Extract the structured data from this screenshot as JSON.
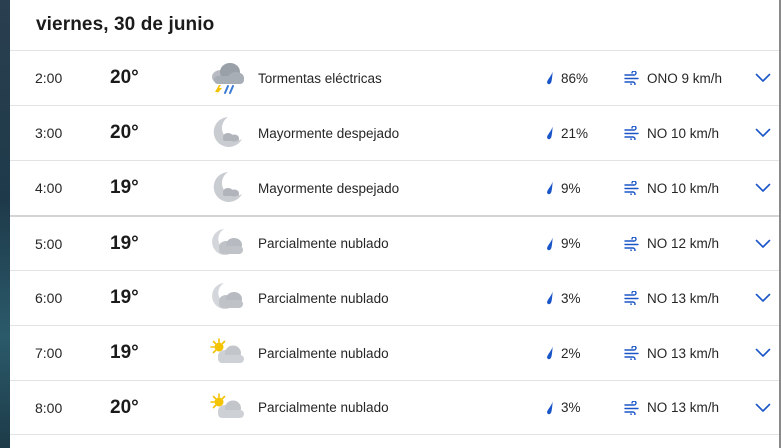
{
  "header": {
    "date": "viernes, 30 de junio"
  },
  "rows": [
    {
      "time": "2:00",
      "temp": "20°",
      "icon": "thunderstorm-icon",
      "condition": "Tormentas eléctricas",
      "precip": "86%",
      "wind": "ONO 9 km/h"
    },
    {
      "time": "3:00",
      "temp": "20°",
      "icon": "mostly-clear-night-icon",
      "condition": "Mayormente despejado",
      "precip": "21%",
      "wind": "NO 10 km/h"
    },
    {
      "time": "4:00",
      "temp": "19°",
      "icon": "mostly-clear-night-icon",
      "condition": "Mayormente despejado",
      "precip": "9%",
      "wind": "NO 10 km/h"
    },
    {
      "time": "5:00",
      "temp": "19°",
      "icon": "partly-cloudy-night-icon",
      "condition": "Parcialmente nublado",
      "precip": "9%",
      "wind": "NO 12 km/h"
    },
    {
      "time": "6:00",
      "temp": "19°",
      "icon": "partly-cloudy-night-icon",
      "condition": "Parcialmente nublado",
      "precip": "3%",
      "wind": "NO 13 km/h"
    },
    {
      "time": "7:00",
      "temp": "19°",
      "icon": "partly-cloudy-day-icon",
      "condition": "Parcialmente nublado",
      "precip": "2%",
      "wind": "NO 13 km/h"
    },
    {
      "time": "8:00",
      "temp": "20°",
      "icon": "partly-cloudy-day-icon",
      "condition": "Parcialmente nublado",
      "precip": "3%",
      "wind": "NO 13 km/h"
    }
  ],
  "colors": {
    "accent": "#1a56c8",
    "drop": "#1a56c8",
    "text": "#1b1b1b",
    "divider": "#e3e3e3"
  }
}
